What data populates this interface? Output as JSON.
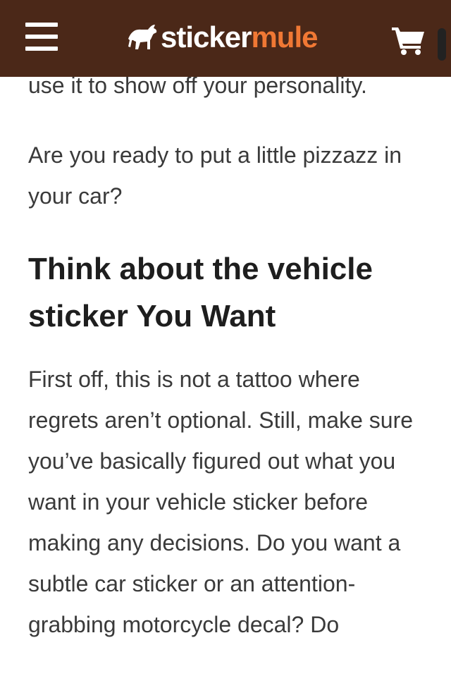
{
  "header": {
    "menu_icon": "hamburger-menu-icon",
    "logo": {
      "part1": "sticker",
      "part2": "mule",
      "icon": "mule-logo-icon",
      "colors": {
        "sticker": "#ffffff",
        "mule": "#f07834"
      }
    },
    "cart_icon": "shopping-cart-icon",
    "background_color": "#4b2818"
  },
  "article": {
    "partial_line": "use it to show off your personality.",
    "paragraph_1": "Are you ready to put a little pizzazz in your car?",
    "heading": "Think about the vehicle sticker You Want",
    "paragraph_2": "First off, this is not a tattoo where regrets aren’t optional. Still, make sure you’ve basically figured out what you want in your vehicle sticker before making any decisions. Do you want a subtle car sticker or an attention-grabbing motorcycle decal? Do"
  }
}
